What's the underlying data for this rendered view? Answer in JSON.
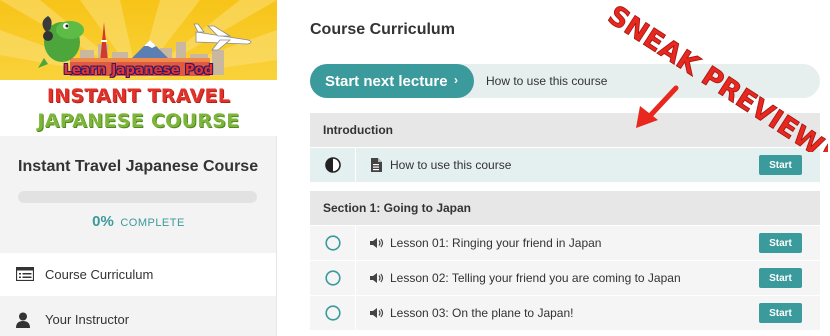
{
  "sidebar": {
    "banner": {
      "line1": "Learn Japanese Pod",
      "line2": "INSTANT TRAVEL",
      "line3": "JAPANESE COURSE"
    },
    "course_title": "Instant Travel Japanese Course",
    "progress": {
      "percent_value": 0,
      "percent": "0%",
      "label": "COMPLETE"
    },
    "nav": [
      {
        "label": "Course Curriculum",
        "icon": "list-icon",
        "active": true
      },
      {
        "label": "Your Instructor",
        "icon": "user-icon",
        "active": false
      }
    ]
  },
  "main": {
    "title": "Course Curriculum",
    "next": {
      "button_label": "Start next lecture",
      "chevron": "›",
      "lesson": "How to use this course"
    },
    "sections": [
      {
        "title": "Introduction",
        "lessons": [
          {
            "title": "How to use this course",
            "icon": "document-icon",
            "status": "half",
            "action": "Start"
          }
        ]
      },
      {
        "title": "Section 1: Going to Japan",
        "lessons": [
          {
            "title": "Lesson 01: Ringing your friend in Japan",
            "icon": "audio-icon",
            "status": "empty",
            "action": "Start"
          },
          {
            "title": "Lesson 02: Telling your friend you are coming to Japan",
            "icon": "audio-icon",
            "status": "empty",
            "action": "Start"
          },
          {
            "title": "Lesson 03: On the plane to Japan!",
            "icon": "audio-icon",
            "status": "empty",
            "action": "Start"
          }
        ]
      }
    ]
  },
  "overlay": {
    "text": "SNEAK PREVIEW!",
    "color": "#e8271f"
  },
  "colors": {
    "accent": "#3b9a9c",
    "banner_yellow": "#f7c418"
  }
}
